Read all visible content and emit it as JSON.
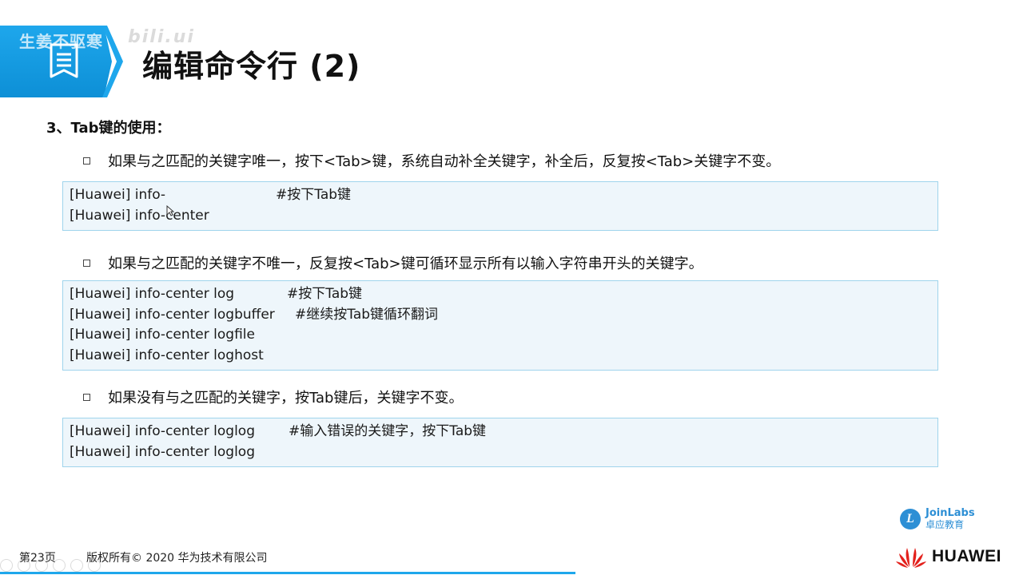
{
  "banner": {
    "watermark": "生姜不驱寒",
    "watermark_hand": "bili.ui"
  },
  "page_title": "编辑命令行 (2)",
  "section_heading": "3、Tab键的使用：",
  "bullets": [
    "如果与之匹配的关键字唯一，按下<Tab>键，系统自动补全关键字，补全后，反复按<Tab>关键字不变。",
    "如果与之匹配的关键字不唯一，反复按<Tab>键可循环显示所有以输入字符串开头的关键字。",
    "如果没有与之匹配的关键字，按Tab键后，关键字不变。"
  ],
  "code_blocks": [
    {
      "lines": [
        {
          "cmd": "[Huawei] info-",
          "comment": "#按下Tab键"
        },
        {
          "cmd": "[Huawei] info-center",
          "comment": ""
        }
      ]
    },
    {
      "lines": [
        {
          "cmd": "[Huawei] info-center log",
          "comment": "#按下Tab键"
        },
        {
          "cmd": "[Huawei] info-center logbuffer",
          "comment": "#继续按Tab键循环翻词"
        },
        {
          "cmd": "[Huawei] info-center logfile",
          "comment": ""
        },
        {
          "cmd": "[Huawei] info-center loghost",
          "comment": ""
        }
      ]
    },
    {
      "lines": [
        {
          "cmd": "[Huawei] info-center loglog",
          "comment": "#输入错误的关键字，按下Tab键"
        },
        {
          "cmd": "[Huawei] info-center loglog",
          "comment": ""
        }
      ]
    }
  ],
  "footer": {
    "page_number": "第23页",
    "copyright": "版权所有© 2020 华为技术有限公司"
  },
  "joinlabs": {
    "en": "JoinLabs",
    "cn": "卓应教育"
  },
  "huawei": {
    "name": "HUAWEI",
    "logo_color": "#e3211c"
  },
  "colors": {
    "accent": "#1ea7ec",
    "code_bg": "#eef6fb",
    "code_border": "#9fd4ec"
  }
}
